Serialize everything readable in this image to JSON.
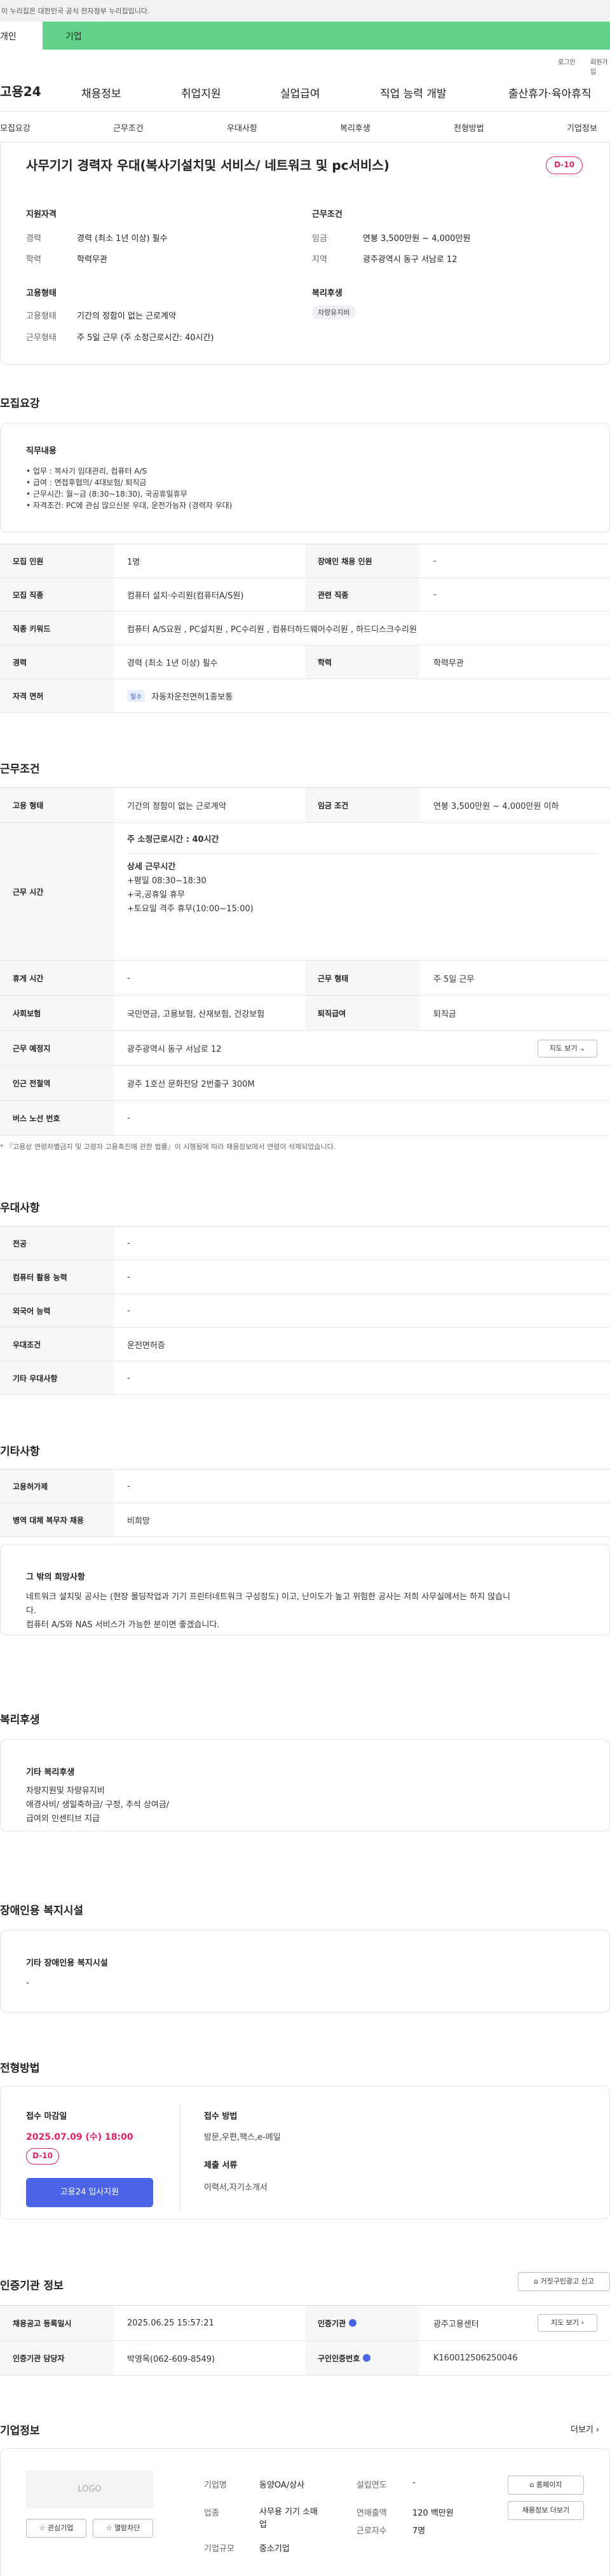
{
  "gov_banner": "이 누리집은 대한민국 공식 전자정부 누리집입니다.",
  "top_tabs": {
    "individual": "개인",
    "business": "기업"
  },
  "util": {
    "login": "로그인",
    "join": "회원가입"
  },
  "brand": "고용24",
  "gnb": [
    "채용정보",
    "취업지원",
    "실업급여",
    "직업 능력 개발",
    "출산휴가·육아휴직"
  ],
  "anchors": [
    "모집요강",
    "근무조건",
    "우대사항",
    "복리후생",
    "전형방법",
    "기업정보"
  ],
  "job": {
    "title": "사무기기 경력자 우대(복사기설치및 서비스/ 네트워크 및 pc서비스)",
    "dday": "D-10",
    "qual_title": "지원자격",
    "career_l": "경력",
    "career_v": "경력 (최소 1년 이상) 필수",
    "edu_l": "학력",
    "edu_v": "학력무관",
    "cond_title": "근무조건",
    "wage_l": "임금",
    "wage_v": "연봉 3,500만원 ~ 4,000만원",
    "region_l": "지역",
    "region_v": "광주광역시 동구 서남로 12",
    "emp_title": "고용형태",
    "emptype_l": "고용형태",
    "emptype_v": "기간의 정함이 없는 근로계약",
    "worktype_l": "근무형태",
    "worktype_v": "주 5일 근무 (주 소정근로시간: 40시간)",
    "welfare_title": "복리후생",
    "welfare_tag": "차량유지비"
  },
  "recruit": {
    "section": "모집요강",
    "duty_title": "직무내용",
    "duty_lines": [
      "• 업무 : 복사기 임대관리, 컴퓨터 A/S",
      "• 급여 : 면접후협의/ 4대보험/ 퇴직금",
      "• 근무시간: 월~금 (8:30~18:30), 국공휴일휴무",
      "• 자격조건: PC에 관심 많으신분 우대, 운전가능자 (경력자 우대)"
    ],
    "headcount_l": "모집 인원",
    "headcount_v": "1명",
    "disabled_l": "장애인 채용 인원",
    "disabled_v": "-",
    "jobcat_l": "모집 직종",
    "jobcat_v": "컴퓨터 설치·수리원(컴퓨터A/S원)",
    "related_l": "관련 직종",
    "related_v": "-",
    "keyword_l": "직종 키워드",
    "keyword_v": "컴퓨터 A/S요원 , PC설치원 , PC수리원 , 컴퓨터하드웨어수리원 , 하드디스크수리원",
    "career_l": "경력",
    "career_v": "경력 (최소 1년 이상) 필수",
    "edu_l": "학력",
    "edu_v": "학력무관",
    "license_l": "자격 면허",
    "license_tag": "필수",
    "license_v": "자동차운전면허1종보통"
  },
  "work": {
    "section": "근무조건",
    "emp_l": "고용 형태",
    "emp_v": "기간의 정함이 없는 근로계약",
    "wage_l": "임금 조건",
    "wage_v": "연봉 3,500만원 ~ 4,000만원 이하",
    "hours_l": "근무 시간",
    "hours_head": "주 소정근로시간 : ",
    "hours_num": "40시간",
    "hours_detail_title": "상세 근무시간",
    "hours_lines": [
      "+평일 08:30~18:30",
      "+국,공휴일 휴무",
      "+토요일 격주 휴무(10:00~15:00)"
    ],
    "rest_l": "휴게 시간",
    "rest_v": "-",
    "shape_l": "근무 형태",
    "shape_v": "주 5일 근무",
    "ins_l": "사회보험",
    "ins_v": "국민연금, 고용보험, 산재보험, 건강보험",
    "sev_l": "퇴직급여",
    "sev_v": "퇴직금",
    "place_l": "근무 예정지",
    "place_v": "광주광역시 동구 서남로 12",
    "map_btn": "지도 보기",
    "subway_l": "인근 전철역",
    "subway_v": "광주 1호선 문화전당 2번출구 300M",
    "bus_l": "버스 노선 번호",
    "bus_v": "-",
    "note": "* 『고용상 연령차별금지 및 고령자 고용촉진에 관한 법률』이 시행됨에 따라 채용정보에서 연령이 삭제되었습니다."
  },
  "pref": {
    "section": "우대사항",
    "major_l": "전공",
    "major_v": "-",
    "pc_l": "컴퓨터 활용 능력",
    "pc_v": "-",
    "lang_l": "외국어 능력",
    "lang_v": "-",
    "cond_l": "우대조건",
    "cond_v": "운전면허증",
    "etc_l": "기타 우대사항",
    "etc_v": "-"
  },
  "other": {
    "section": "기타사항",
    "type_l": "고용허가제",
    "type_v": "-",
    "mil_l": "병역 대체 복무자 채용",
    "mil_v": "비희망",
    "wish_title": "그 밖의 희망사항",
    "wish_lines": [
      "네트워크 설치및 공사는 (현장 몰딩작업과 기기 프린터네트워크 구성정도) 이고, 난이도가 높고 위험한 공사는 저희 사무실에서는 하지 않습니",
      "다.",
      "컴퓨터 A/S와 NAS 서비스가 가능한 분이면 좋겠습니다."
    ]
  },
  "welfare": {
    "section": "복리후생",
    "box_title": "기타 복리후생",
    "lines": [
      "차량지원및 차량유지비",
      "애경사비/ 생일축하금/ 구정, 추석 상여금/",
      "급여외 인센티브 지급"
    ]
  },
  "facility": {
    "section": "장애인용 복지시설",
    "box_title": "기타 장애인용 복지시설",
    "value": "-"
  },
  "process": {
    "section": "전형방법",
    "deadline_title": "접수 마감일",
    "deadline": "2025.07.09 (수) 18:00",
    "dday": "D-10",
    "apply_btn": "고용24 입사지원",
    "method_title": "접수 방법",
    "method_v": "방문,우편,팩스,e-메일",
    "docs_title": "제출 서류",
    "docs_v": "이력서,자기소개서"
  },
  "agency": {
    "section": "인증기관 정보",
    "report_btn": "거짓구인광고 신고",
    "reg_l": "채용공고 등록일시",
    "reg_v": "2025.06.25 15:57:21",
    "org_l": "인증기관",
    "org_v": "광주고용센터",
    "map_btn": "지도 보기",
    "staff_l": "인증기관 담당자",
    "staff_v": "박영옥(062-609-8549)",
    "no_l": "구인인증번호",
    "no_v": "K160012506250046"
  },
  "company": {
    "section": "기업정보",
    "more": "더보기",
    "logo": "LOGO",
    "fav_btn": "관심기업",
    "block_btn": "열람차단",
    "name_l": "기업명",
    "name_v": "동양OA/상사",
    "ind_l": "업종",
    "ind_v1": "사무용 기기 소매",
    "ind_v2": "업",
    "size_l": "기업규모",
    "size_v": "중소기업",
    "year_l": "설립연도",
    "year_v": "-",
    "sales_l": "연매출액",
    "sales_v": "120 백만원",
    "staff_l": "근로자수",
    "staff_v": "7명",
    "home_btn": "홈페이지",
    "jobs_btn": "채용정보 더보기"
  }
}
